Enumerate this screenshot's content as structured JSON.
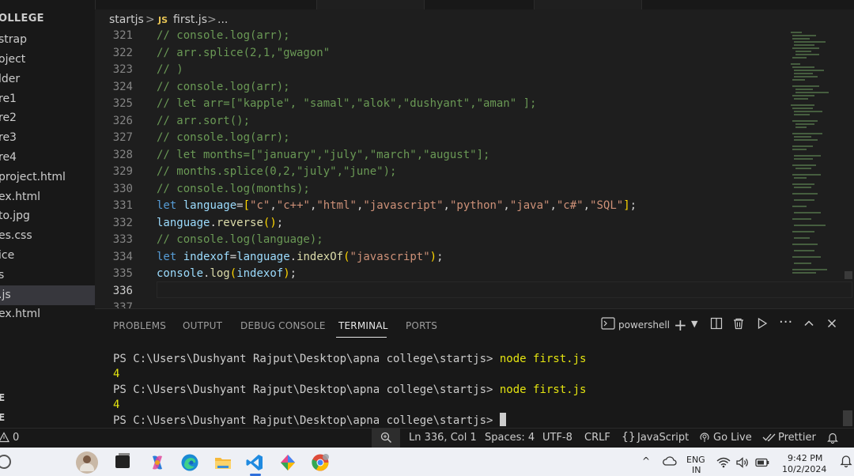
{
  "sidebar": {
    "title": "OLLEGE",
    "items": [
      {
        "label": "strap",
        "active": false
      },
      {
        "label": "oject",
        "active": false
      },
      {
        "label": "lder",
        "active": false
      },
      {
        "label": "re1",
        "active": false
      },
      {
        "label": "re2",
        "active": false
      },
      {
        "label": "re3",
        "active": false
      },
      {
        "label": "re4",
        "active": false
      },
      {
        "label": "project.html",
        "active": false
      },
      {
        "label": "ex.html",
        "active": false
      },
      {
        "label": "to.jpg",
        "active": false
      },
      {
        "label": "es.css",
        "active": false
      },
      {
        "label": "ice",
        "active": false
      },
      {
        "label": "s",
        "active": false
      },
      {
        "label": ".js",
        "active": true
      },
      {
        "label": "ex.html",
        "active": false
      }
    ],
    "section1": "E",
    "section2": "E"
  },
  "breadcrumb": {
    "folder": "startjs",
    "sep": ">",
    "js_badge": "JS",
    "file": "first.js",
    "sep2": ">",
    "ellipsis": "..."
  },
  "editor": {
    "line_numbers": [
      "321",
      "322",
      "323",
      "324",
      "325",
      "326",
      "327",
      "328",
      "329",
      "330",
      "331",
      "332",
      "333",
      "334",
      "335",
      "336",
      "337"
    ],
    "current_line": "336"
  },
  "panel": {
    "tabs": [
      "PROBLEMS",
      "OUTPUT",
      "DEBUG CONSOLE",
      "TERMINAL",
      "PORTS"
    ],
    "active_tab": "TERMINAL",
    "shell": "powershell",
    "terminal": [
      {
        "prompt": "PS C:\\Users\\Dushyant Rajput\\Desktop\\apna college\\startjs> ",
        "cmd": "node first.js"
      },
      {
        "output": "4"
      },
      {
        "prompt": "PS C:\\Users\\Dushyant Rajput\\Desktop\\apna college\\startjs> ",
        "cmd": "node first.js"
      },
      {
        "output": "4"
      },
      {
        "prompt": "PS C:\\Users\\Dushyant Rajput\\Desktop\\apna college\\startjs> ",
        "cmd": ""
      }
    ]
  },
  "statusbar": {
    "problems": "0",
    "position": "Ln 336, Col 1",
    "spaces": "Spaces: 4",
    "encoding": "UTF-8",
    "eol": "CRLF",
    "language": "JavaScript",
    "golive": "Go Live",
    "prettier": "Prettier"
  },
  "taskbar": {
    "lang_top": "ENG",
    "lang_bottom": "IN",
    "time": "9:42 PM",
    "date": "10/2/2024"
  },
  "colors": {
    "comment": "#6a9955",
    "keyword": "#569cd6",
    "string": "#ce9178",
    "variable": "#9cdcfe",
    "function": "#dcdcaa",
    "terminal_cmd": "#e5e510"
  }
}
